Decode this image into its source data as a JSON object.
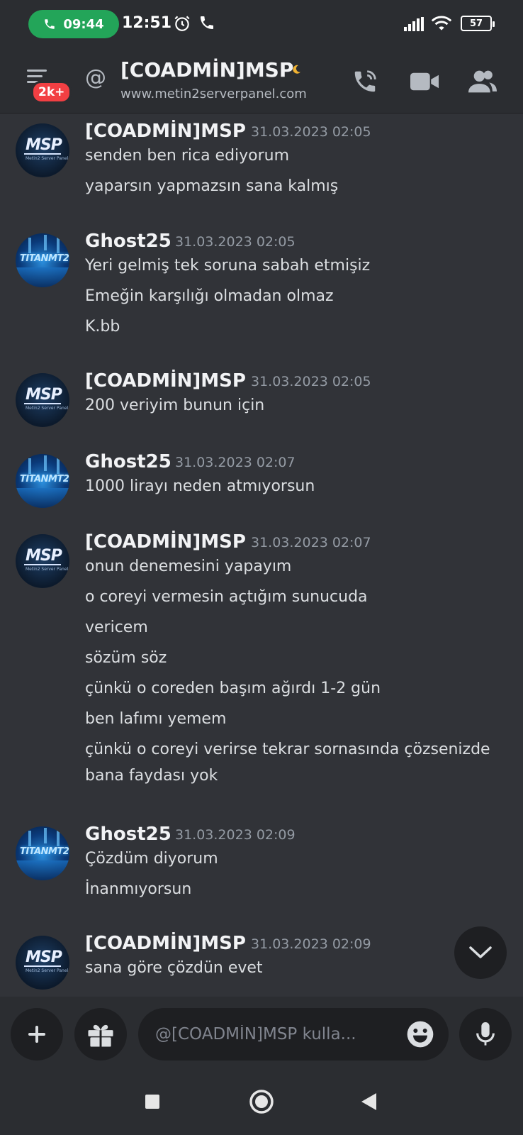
{
  "status_bar": {
    "call_time": "09:44",
    "clock": "12:51",
    "battery": "57"
  },
  "header": {
    "unread_badge": "2k+",
    "at_symbol": "@",
    "title": "[COADMİN]MSP",
    "subtitle": "www.metin2serverpanel.com"
  },
  "messages": [
    {
      "author": "[COADMİN]MSP",
      "time": "31.03.2023 02:05",
      "avatar": "msp-logo",
      "avatar_text": "MSP",
      "avatar_tagline": "Metin2 Server Panel",
      "lines": [
        "senden ben rica ediyorum",
        "yaparsın yapmazsın sana kalmış"
      ]
    },
    {
      "author": "Ghost25",
      "time": "31.03.2023 02:05",
      "avatar": "titan-logo",
      "avatar_text": "TITANMT2",
      "lines": [
        "Yeri gelmiş tek soruna sabah etmişiz",
        "Emeğin karşılığı olmadan olmaz",
        "K.bb"
      ]
    },
    {
      "author": "[COADMİN]MSP",
      "time": "31.03.2023 02:05",
      "avatar": "msp-logo",
      "avatar_text": "MSP",
      "avatar_tagline": "Metin2 Server Panel",
      "lines": [
        "200 veriyim bunun için"
      ]
    },
    {
      "author": "Ghost25",
      "time": "31.03.2023 02:07",
      "avatar": "titan-logo",
      "avatar_text": "TITANMT2",
      "lines": [
        "1000 lirayı neden atmıyorsun"
      ]
    },
    {
      "author": "[COADMİN]MSP",
      "time": "31.03.2023 02:07",
      "avatar": "msp-logo",
      "avatar_text": "MSP",
      "avatar_tagline": "Metin2 Server Panel",
      "lines": [
        "onun denemesini yapayım",
        "o coreyi vermesin açtığım sunucuda",
        "vericem",
        "sözüm söz",
        "çünkü o coreden başım ağırdı 1-2 gün",
        "ben lafımı yemem",
        "çünkü o coreyi verirse tekrar sornasında çözsenizde",
        "bana faydası yok"
      ]
    },
    {
      "author": "Ghost25",
      "time": "31.03.2023 02:09",
      "avatar": "titan-logo",
      "avatar_text": "TITANMT2",
      "lines": [
        "Çözdüm diyorum",
        "İnanmıyorsun"
      ]
    },
    {
      "author": "[COADMİN]MSP",
      "time": "31.03.2023 02:09",
      "avatar": "msp-logo",
      "avatar_text": "MSP",
      "avatar_tagline": "Metin2 Server Panel",
      "lines": [
        "sana göre çözdün evet"
      ]
    }
  ],
  "composer": {
    "placeholder": "@[COADMİN]MSP kulla..."
  },
  "colors": {
    "background": "#313338",
    "header": "#2b2d31",
    "call_green": "#23a559",
    "badge_red": "#f23f43",
    "username": "#f2f3f5",
    "timestamp": "#949ba4",
    "message_text": "#dbdee1"
  },
  "icons": [
    "phone-icon",
    "alarm-icon",
    "signal-icon",
    "wifi-icon",
    "battery-icon",
    "hamburger-icon",
    "at-icon",
    "moon-icon",
    "voice-call-icon",
    "video-icon",
    "members-icon",
    "chevron-down-icon",
    "plus-icon",
    "gift-icon",
    "emoji-icon",
    "microphone-icon",
    "square-icon",
    "circle-icon",
    "triangle-back-icon"
  ]
}
